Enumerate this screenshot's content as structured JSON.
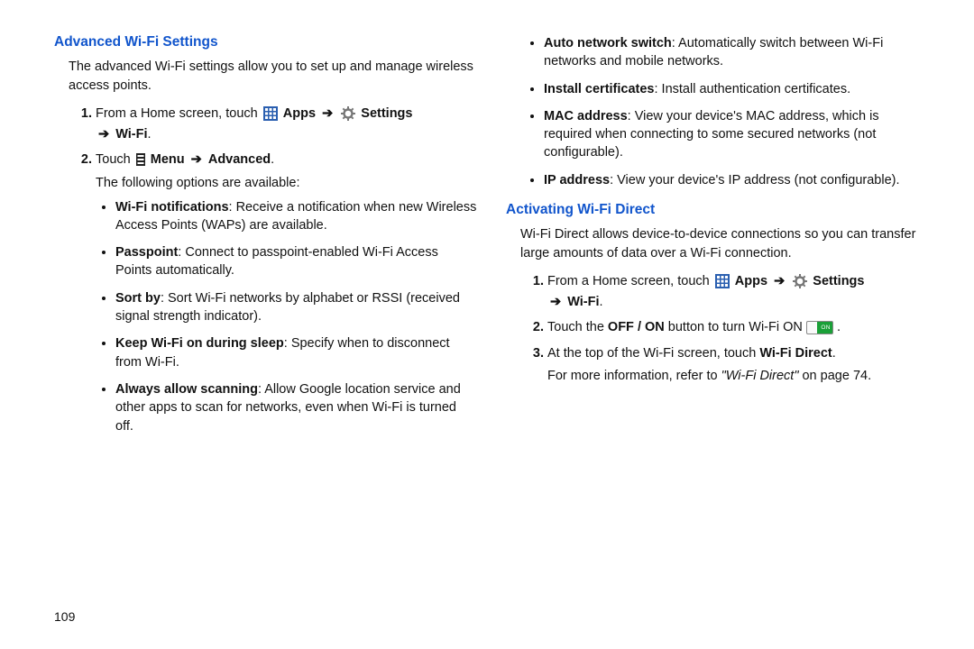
{
  "page_number": "109",
  "left": {
    "heading": "Advanced Wi-Fi Settings",
    "intro": "The advanced Wi-Fi settings allow you to set up and manage wireless access points.",
    "step1_pre": "From a Home screen, touch ",
    "step1_apps": "Apps",
    "step1_settings": "Settings",
    "step1_wifi": "Wi-Fi",
    "step2_pre": "Touch ",
    "step2_menu": "Menu",
    "step2_adv": "Advanced",
    "step2_tail": "The following options are available:",
    "opts": [
      {
        "b": "Wi-Fi notifications",
        "t": ": Receive a notification when new Wireless Access Points (WAPs) are available."
      },
      {
        "b": "Passpoint",
        "t": ": Connect to passpoint-enabled Wi-Fi Access Points automatically."
      },
      {
        "b": "Sort by",
        "t": ": Sort Wi-Fi networks by alphabet or RSSI (received signal strength indicator)."
      },
      {
        "b": "Keep Wi-Fi on during sleep",
        "t": ": Specify when to disconnect from Wi-Fi."
      },
      {
        "b": "Always allow scanning",
        "t": ": Allow Google location service and other apps to scan for networks, even when Wi-Fi is turned off."
      }
    ]
  },
  "right": {
    "opts_top": [
      {
        "b": "Auto network switch",
        "t": ": Automatically switch between Wi-Fi networks and mobile networks."
      },
      {
        "b": "Install certificates",
        "t": ": Install authentication certificates."
      },
      {
        "b": "MAC address",
        "t": ": View your device's MAC address, which is required when connecting to some secured networks (not configurable)."
      },
      {
        "b": "IP address",
        "t": ": View your device's IP address (not configurable)."
      }
    ],
    "heading": "Activating Wi-Fi Direct",
    "intro": "Wi-Fi Direct allows device-to-device connections so you can transfer large amounts of data over a Wi-Fi connection.",
    "step1_pre": "From a Home screen, touch ",
    "step1_apps": "Apps",
    "step1_settings": "Settings",
    "step1_wifi": "Wi-Fi",
    "step2_a": "Touch the ",
    "step2_b": "OFF / ON",
    "step2_c": " button to turn Wi-Fi ON ",
    "step3_a": "At the top of the Wi-Fi screen, touch ",
    "step3_b": "Wi-Fi Direct",
    "step3_c": "For more information, refer to ",
    "step3_d": "\"Wi-Fi Direct\"",
    "step3_e": " on page 74."
  },
  "arrow": "➔",
  "period": "."
}
